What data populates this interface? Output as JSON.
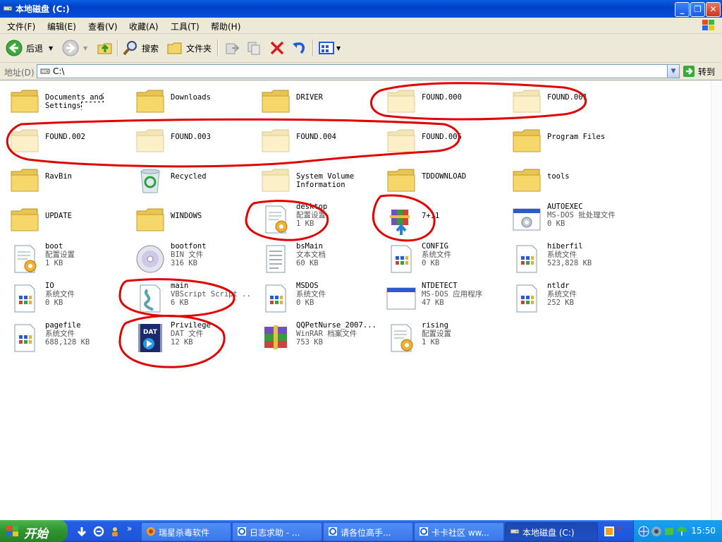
{
  "window": {
    "title": "本地磁盘 (C:)"
  },
  "menu": [
    "文件(F)",
    "编辑(E)",
    "查看(V)",
    "收藏(A)",
    "工具(T)",
    "帮助(H)"
  ],
  "toolbar": {
    "back": "后退",
    "search": "搜索",
    "folders": "文件夹"
  },
  "address": {
    "label": "地址(D)",
    "value": "C:\\",
    "go": "转到"
  },
  "items": [
    {
      "name": "Documents and Settings",
      "type": "folder"
    },
    {
      "name": "Downloads",
      "type": "folder"
    },
    {
      "name": "DRIVER",
      "type": "folder"
    },
    {
      "name": "FOUND.000",
      "type": "folder-hidden"
    },
    {
      "name": "FOUND.001",
      "type": "folder-hidden"
    },
    {
      "name": "FOUND.002",
      "type": "folder-hidden"
    },
    {
      "name": "FOUND.003",
      "type": "folder-hidden"
    },
    {
      "name": "FOUND.004",
      "type": "folder-hidden"
    },
    {
      "name": "FOUND.005",
      "type": "folder-hidden"
    },
    {
      "name": "Program Files",
      "type": "folder"
    },
    {
      "name": "RavBin",
      "type": "folder"
    },
    {
      "name": "Recycled",
      "type": "recycle"
    },
    {
      "name": "System Volume Information",
      "type": "folder-hidden"
    },
    {
      "name": "TDDOWNLOAD",
      "type": "folder"
    },
    {
      "name": "tools",
      "type": "folder"
    },
    {
      "name": "UPDATE",
      "type": "folder"
    },
    {
      "name": "WINDOWS",
      "type": "folder"
    },
    {
      "name": "desktop",
      "line2": "配置设置",
      "line3": "1 KB",
      "type": "ini"
    },
    {
      "name": "7+11",
      "type": "winrar-installer"
    },
    {
      "name": "AUTOEXEC",
      "line2": "MS-DOS 批处理文件",
      "line3": "0 KB",
      "type": "bat"
    },
    {
      "name": "boot",
      "line2": "配置设置",
      "line3": "1 KB",
      "type": "ini"
    },
    {
      "name": "bootfont",
      "line2": "BIN 文件",
      "line3": "316 KB",
      "type": "cd"
    },
    {
      "name": "bsMain",
      "line2": "文本文档",
      "line3": "60 KB",
      "type": "txt"
    },
    {
      "name": "CONFIG",
      "line2": "系统文件",
      "line3": "0 KB",
      "type": "sys"
    },
    {
      "name": "hiberfil",
      "line2": "系统文件",
      "line3": "523,828 KB",
      "type": "sys"
    },
    {
      "name": "IO",
      "line2": "系统文件",
      "line3": "0 KB",
      "type": "sys"
    },
    {
      "name": "main",
      "line2": "VBScript Script ...",
      "line3": "6 KB",
      "type": "vbs"
    },
    {
      "name": "MSDOS",
      "line2": "系统文件",
      "line3": "0 KB",
      "type": "sys"
    },
    {
      "name": "NTDETECT",
      "line2": "MS-DOS 应用程序",
      "line3": "47 KB",
      "type": "app"
    },
    {
      "name": "ntldr",
      "line2": "系统文件",
      "line3": "252 KB",
      "type": "sys"
    },
    {
      "name": "pagefile",
      "line2": "系统文件",
      "line3": "688,128 KB",
      "type": "sys"
    },
    {
      "name": "Privilege",
      "line2": "DAT 文件",
      "line3": "12 KB",
      "type": "dat"
    },
    {
      "name": "QQPetNurse_2007....",
      "line2": "WinRAR 档案文件",
      "line3": "753 KB",
      "type": "rar"
    },
    {
      "name": "rising",
      "line2": "配置设置",
      "line3": "1 KB",
      "type": "ini"
    }
  ],
  "taskbar": {
    "start": "开始",
    "tasks": [
      "瑞星杀毒软件",
      "日志求助 - ...",
      "请各位高手...",
      "卡卡社区 ww...",
      "本地磁盘 (C:)"
    ],
    "clock": "15:50"
  },
  "colors": {
    "titlebar": "#0a4ed8",
    "taskbar": "#235ee4",
    "start": "#2f932f",
    "annotation": "#e00000"
  }
}
